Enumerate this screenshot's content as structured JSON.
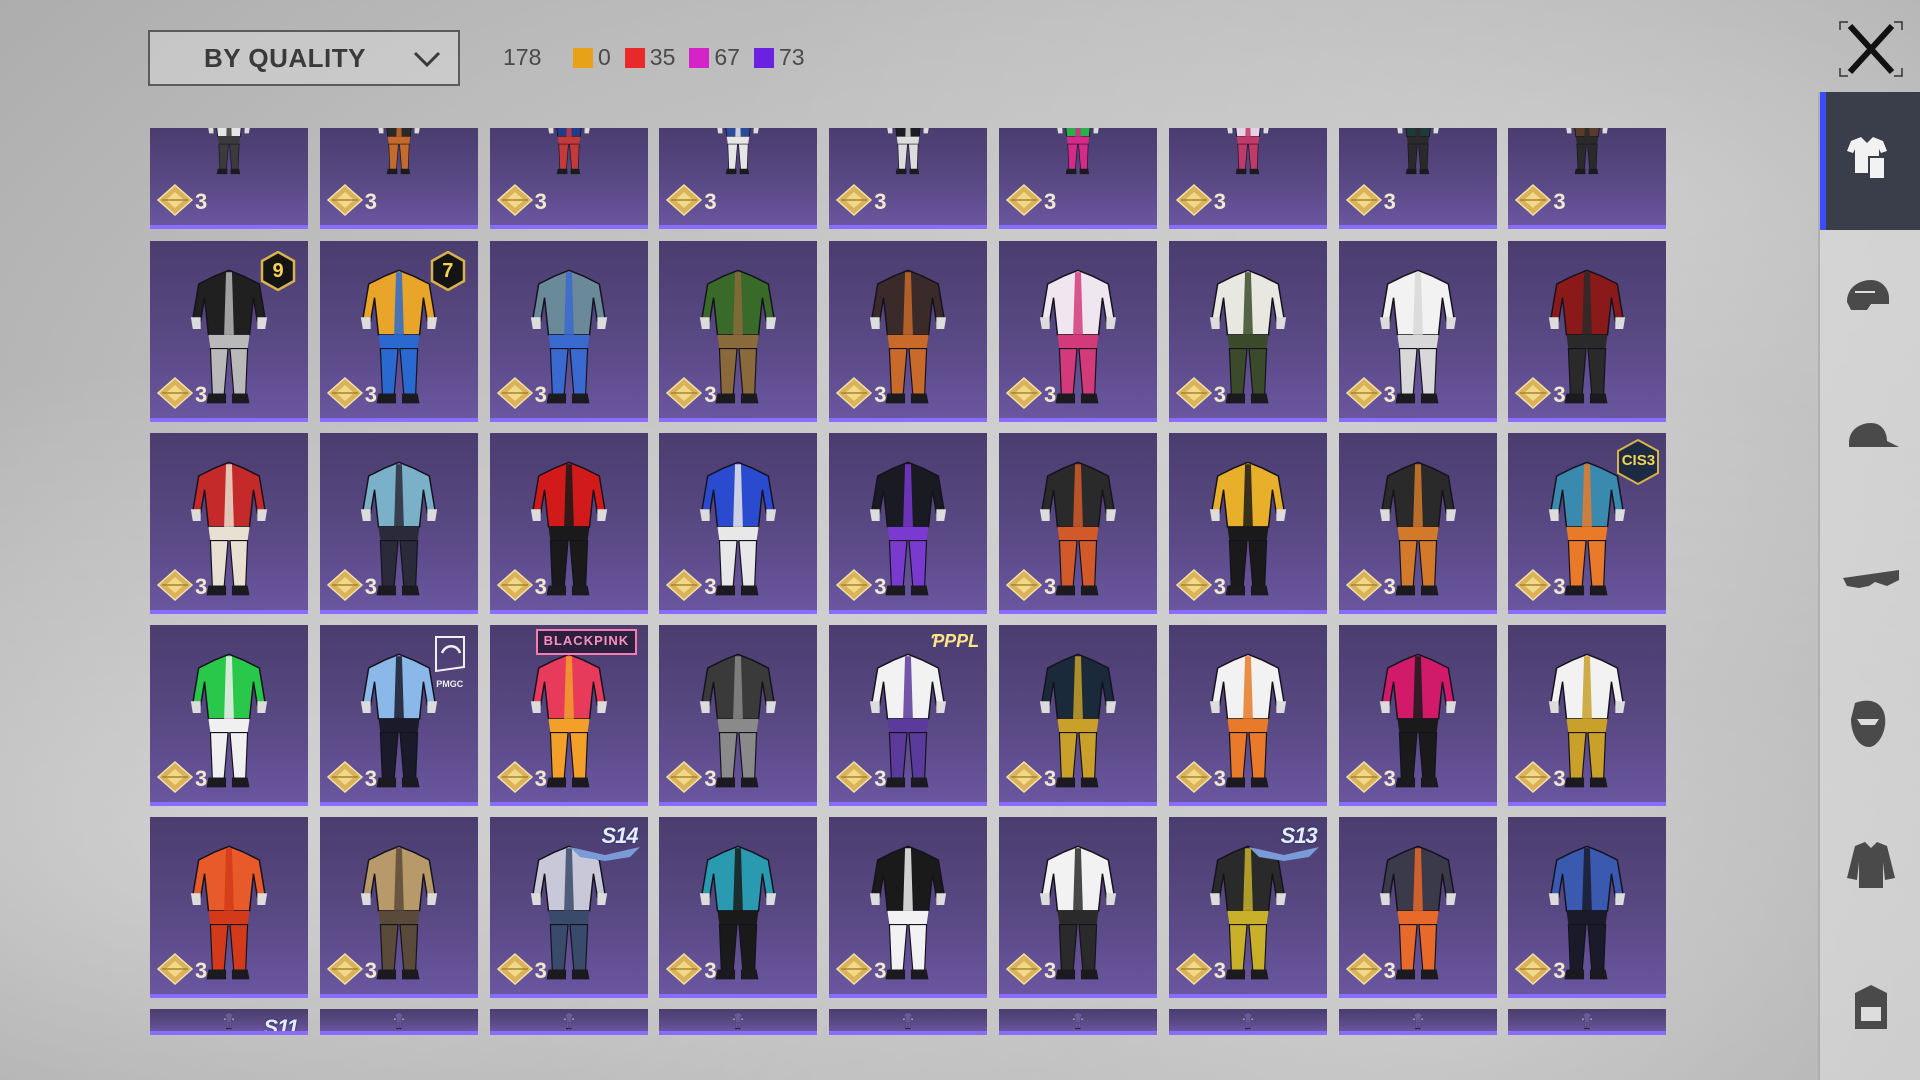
{
  "toolbar": {
    "sort_label": "BY QUALITY",
    "total_count": "178",
    "quality_counts": [
      {
        "color": "#e8a21a",
        "count": "0"
      },
      {
        "color": "#e8282a",
        "count": "35"
      },
      {
        "color": "#d424c8",
        "count": "67"
      },
      {
        "color": "#6a22e0",
        "count": "73"
      }
    ]
  },
  "side_nav": [
    {
      "icon": "outfit-icon",
      "active": true
    },
    {
      "icon": "helmet-icon",
      "active": false
    },
    {
      "icon": "cap-icon",
      "active": false
    },
    {
      "icon": "goggles-icon",
      "active": false
    },
    {
      "icon": "mask-icon",
      "active": false
    },
    {
      "icon": "jacket-icon",
      "active": false
    },
    {
      "icon": "backpack-icon",
      "active": false
    }
  ],
  "rows": [
    {
      "items": [
        {
          "count": "3",
          "colors": [
            "#e6e6e6",
            "#3b3b3b"
          ]
        },
        {
          "count": "3",
          "colors": [
            "#2a2a2a",
            "#c46a2a"
          ]
        },
        {
          "count": "3",
          "colors": [
            "#1f3b8a",
            "#c43a3a"
          ]
        },
        {
          "count": "3",
          "colors": [
            "#2a4a9a",
            "#e6e6e6"
          ]
        },
        {
          "count": "3",
          "colors": [
            "#1c1c22",
            "#dddddd"
          ]
        },
        {
          "count": "3",
          "colors": [
            "#2ab04a",
            "#d62a8a"
          ]
        },
        {
          "count": "3",
          "colors": [
            "#e8d2e6",
            "#c23a6a"
          ]
        },
        {
          "count": "3",
          "colors": [
            "#1e3a3a",
            "#2a2a2a"
          ]
        },
        {
          "count": "3",
          "colors": [
            "#5a3a2a",
            "#2a2a2a"
          ]
        }
      ]
    },
    {
      "items": [
        {
          "count": "3",
          "colors": [
            "#202020",
            "#b9b9b9"
          ],
          "tag": {
            "type": "hex",
            "text": "9"
          }
        },
        {
          "count": "3",
          "colors": [
            "#e8a52a",
            "#2a6ad0"
          ],
          "tag": {
            "type": "hex",
            "text": "7"
          }
        },
        {
          "count": "3",
          "colors": [
            "#6a8a9a",
            "#3a6ad0"
          ]
        },
        {
          "count": "3",
          "colors": [
            "#3a6a2a",
            "#8a6a3a"
          ]
        },
        {
          "count": "3",
          "colors": [
            "#3a2a2a",
            "#c86a2a"
          ]
        },
        {
          "count": "3",
          "colors": [
            "#f0e6f0",
            "#d23a7a"
          ]
        },
        {
          "count": "3",
          "colors": [
            "#e8e8e0",
            "#3a4a2a"
          ]
        },
        {
          "count": "3",
          "colors": [
            "#f2f2f2",
            "#d8d8d8"
          ]
        },
        {
          "count": "3",
          "colors": [
            "#8a1a1a",
            "#2a2a2a"
          ]
        }
      ]
    },
    {
      "items": [
        {
          "count": "3",
          "colors": [
            "#c42a2a",
            "#e8e0d0"
          ]
        },
        {
          "count": "3",
          "colors": [
            "#7ab0c8",
            "#2a2a3a"
          ]
        },
        {
          "count": "3",
          "colors": [
            "#d21a1a",
            "#1a1a1a"
          ]
        },
        {
          "count": "3",
          "colors": [
            "#2a4ad0",
            "#e8e8e8"
          ]
        },
        {
          "count": "3",
          "colors": [
            "#1a1a22",
            "#7a3ad0"
          ]
        },
        {
          "count": "3",
          "colors": [
            "#2a2a2a",
            "#d25a2a"
          ]
        },
        {
          "count": "3",
          "colors": [
            "#e8b02a",
            "#1a1a1a"
          ]
        },
        {
          "count": "3",
          "colors": [
            "#2a2a2a",
            "#d27a2a"
          ]
        },
        {
          "count": "3",
          "colors": [
            "#3a8ab0",
            "#e87a2a"
          ],
          "tag": {
            "type": "cis",
            "text": "CIS3"
          }
        }
      ]
    },
    {
      "items": [
        {
          "count": "3",
          "colors": [
            "#2ac84a",
            "#f0f0f0"
          ]
        },
        {
          "count": "3",
          "colors": [
            "#8ab8e8",
            "#1a1a2a"
          ],
          "tag": {
            "type": "pmgc",
            "text": "PMGC"
          }
        },
        {
          "count": "3",
          "colors": [
            "#e83a5a",
            "#f2a02a"
          ],
          "tag": {
            "type": "bp",
            "text": "BLACKPINK"
          }
        },
        {
          "count": "3",
          "colors": [
            "#3a3a3a",
            "#8a8a8a"
          ]
        },
        {
          "count": "3",
          "colors": [
            "#f2f2f2",
            "#5a3a9a"
          ],
          "tag": {
            "type": "pp",
            "text": "ƤPPL"
          }
        },
        {
          "count": "3",
          "colors": [
            "#1a2a3a",
            "#c8a02a"
          ]
        },
        {
          "count": "3",
          "colors": [
            "#f2f2f2",
            "#e87a2a"
          ]
        },
        {
          "count": "3",
          "colors": [
            "#d21a6a",
            "#1a1a1a"
          ]
        },
        {
          "count": "3",
          "colors": [
            "#f2f2f2",
            "#c8a02a"
          ]
        }
      ]
    },
    {
      "items": [
        {
          "count": "3",
          "colors": [
            "#e85a2a",
            "#d23a1a"
          ]
        },
        {
          "count": "3",
          "colors": [
            "#b89a6a",
            "#5a4a3a"
          ]
        },
        {
          "count": "3",
          "colors": [
            "#c8c8d8",
            "#3a4a6a"
          ],
          "tag": {
            "type": "season",
            "text": "S14"
          }
        },
        {
          "count": "3",
          "colors": [
            "#2a9ab0",
            "#1a1a1a"
          ]
        },
        {
          "count": "3",
          "colors": [
            "#1a1a1a",
            "#f2f2f2"
          ]
        },
        {
          "count": "3",
          "colors": [
            "#f2f2f2",
            "#2a2a2a"
          ]
        },
        {
          "count": "3",
          "colors": [
            "#2a2a2a",
            "#c8b02a"
          ],
          "tag": {
            "type": "season",
            "text": "S13"
          }
        },
        {
          "count": "3",
          "colors": [
            "#3a3a4a",
            "#e86a2a"
          ]
        },
        {
          "count": "3",
          "colors": [
            "#3a5ab0",
            "#1a1a2a"
          ]
        }
      ]
    },
    {
      "items": [
        {
          "count": "",
          "colors": [
            "#6a5a9a",
            "#6a5a9a"
          ],
          "tag": {
            "type": "season",
            "text": "S11"
          }
        },
        {
          "count": "",
          "colors": [
            "#6a5a9a",
            "#6a5a9a"
          ]
        },
        {
          "count": "",
          "colors": [
            "#6a5a9a",
            "#6a5a9a"
          ]
        },
        {
          "count": "",
          "colors": [
            "#6a5a9a",
            "#6a5a9a"
          ]
        },
        {
          "count": "",
          "colors": [
            "#6a5a9a",
            "#6a5a9a"
          ]
        },
        {
          "count": "",
          "colors": [
            "#6a5a9a",
            "#6a5a9a"
          ]
        },
        {
          "count": "",
          "colors": [
            "#6a5a9a",
            "#6a5a9a"
          ]
        },
        {
          "count": "",
          "colors": [
            "#6a5a9a",
            "#6a5a9a"
          ]
        },
        {
          "count": "",
          "colors": [
            "#6a5a9a",
            "#6a5a9a"
          ]
        }
      ]
    }
  ]
}
